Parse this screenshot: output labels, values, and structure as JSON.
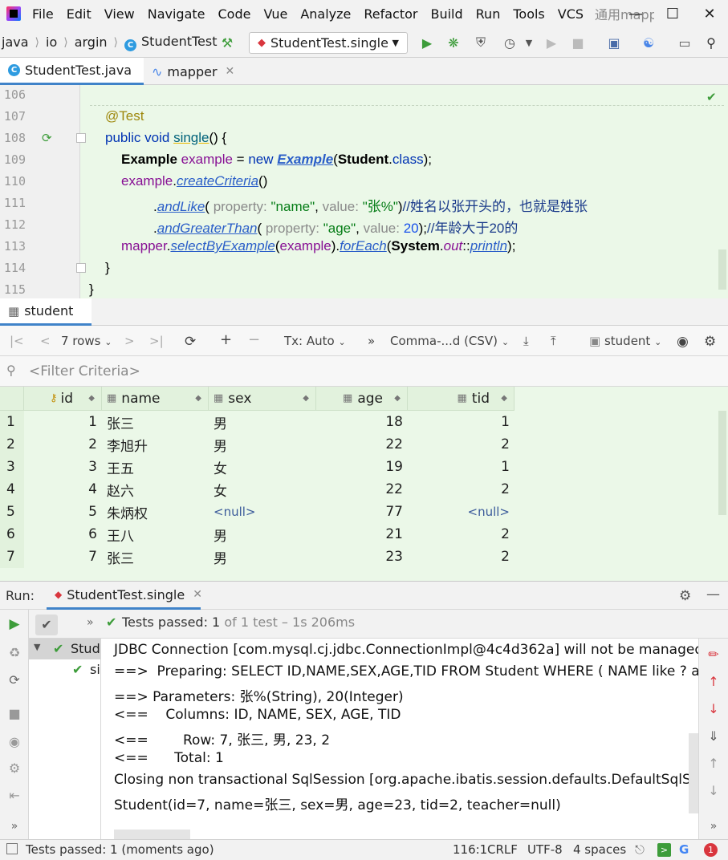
{
  "menu": {
    "items": [
      "File",
      "Edit",
      "View",
      "Navigate",
      "Code",
      "Vue",
      "Analyze",
      "Refactor",
      "Build",
      "Run",
      "Tools",
      "VCS"
    ],
    "project_title": "通用mapper"
  },
  "nav": {
    "crumbs": [
      "java",
      "io",
      "argin",
      "StudentTest"
    ],
    "run_config": "StudentTest.single"
  },
  "tabs": [
    {
      "label": "StudentTest.java",
      "active": true
    },
    {
      "label": "mapper",
      "active": false
    }
  ],
  "editor": {
    "line_numbers": [
      "106",
      "107",
      "108",
      "109",
      "110",
      "111",
      "112",
      "113",
      "114",
      "115"
    ],
    "annotation": "@Test",
    "kw_public": "public",
    "kw_void": "void",
    "method_name": "single",
    "method_tail": "() {",
    "l109_type": "Example",
    "l109_var": "example",
    "l109_eq": " = ",
    "l109_new": "new",
    "l109_ctor": "Example",
    "l109_arg_cls": "Student",
    "l109_dot": ".",
    "l109_kw_class": "class",
    "l109_tail": ");",
    "l110_var": "example",
    "l110_call": "createCriteria",
    "l110_tail": "()",
    "l111_call": "andLike",
    "l111_hint1": "property:",
    "l111_arg1": "\"name\"",
    "l111_hint2": "value:",
    "l111_arg2": "\"张%\"",
    "l111_comment": "//姓名以张开头的，也就是姓张",
    "l112_call": "andGreaterThan",
    "l112_hint1": "property:",
    "l112_arg1": "\"age\"",
    "l112_hint2": "value:",
    "l112_arg2": "20",
    "l112_comment": "//年龄大于20的",
    "l113_var": "mapper",
    "l113_call1": "selectByExample",
    "l113_arg": "example",
    "l113_call2": "forEach",
    "l113_sys": "System",
    "l113_out": "out",
    "l113_ref": "println",
    "l113_tail": ");",
    "close1": "}",
    "close2": "}"
  },
  "db": {
    "tab_label": "student",
    "rows_label": "7 rows",
    "tx_label": "Tx: Auto",
    "export_label": "Comma-...d (CSV)",
    "datasource_label": "student",
    "filter_placeholder": "<Filter Criteria>",
    "columns": [
      "id",
      "name",
      "sex",
      "age",
      "tid"
    ],
    "rows": [
      {
        "n": "1",
        "id": "1",
        "name": "张三",
        "sex": "男",
        "age": "18",
        "tid": "1"
      },
      {
        "n": "2",
        "id": "2",
        "name": "李旭升",
        "sex": "男",
        "age": "22",
        "tid": "2"
      },
      {
        "n": "3",
        "id": "3",
        "name": "王五",
        "sex": "女",
        "age": "19",
        "tid": "1"
      },
      {
        "n": "4",
        "id": "4",
        "name": "赵六",
        "sex": "女",
        "age": "22",
        "tid": "2"
      },
      {
        "n": "5",
        "id": "5",
        "name": "朱炳权",
        "sex": "<null>",
        "age": "77",
        "tid": "<null>"
      },
      {
        "n": "6",
        "id": "6",
        "name": "王八",
        "sex": "男",
        "age": "21",
        "tid": "2"
      },
      {
        "n": "7",
        "id": "7",
        "name": "张三",
        "sex": "男",
        "age": "23",
        "tid": "2"
      }
    ]
  },
  "run": {
    "label": "Run:",
    "tab_label": "StudentTest.single",
    "status_prefix": "Tests passed:",
    "status_count": "1",
    "status_of": "of",
    "status_rest": "1 test – 1s 206ms",
    "tree_root": "Stude",
    "tree_child": "si",
    "console_lines": [
      "JDBC Connection [com.mysql.cj.jdbc.ConnectionImpl@4c4d362a] will not be managed by S",
      "==>  Preparing: SELECT ID,NAME,SEX,AGE,TID FROM Student WHERE ( NAME like ? and AGE",
      "==> Parameters: 张%(String), 20(Integer)",
      "<==    Columns: ID, NAME, SEX, AGE, TID",
      "<==        Row: 7, 张三, 男, 23, 2",
      "<==      Total: 1",
      "Closing non transactional SqlSession [org.apache.ibatis.session.defaults.DefaultSqlSession",
      "Student(id=7, name=张三, sex=男, age=23, tid=2, teacher=null)"
    ]
  },
  "status": {
    "message": "Tests passed: 1 (moments ago)",
    "position": "116:1",
    "line_sep": "CRLF",
    "encoding": "UTF-8",
    "indent": "4 spaces",
    "notifications": "1"
  },
  "colors": {
    "editor_bg": "#ebf8e8",
    "accent": "#4083c9",
    "run_green": "#3d9c3a",
    "error_red": "#d9363e"
  }
}
